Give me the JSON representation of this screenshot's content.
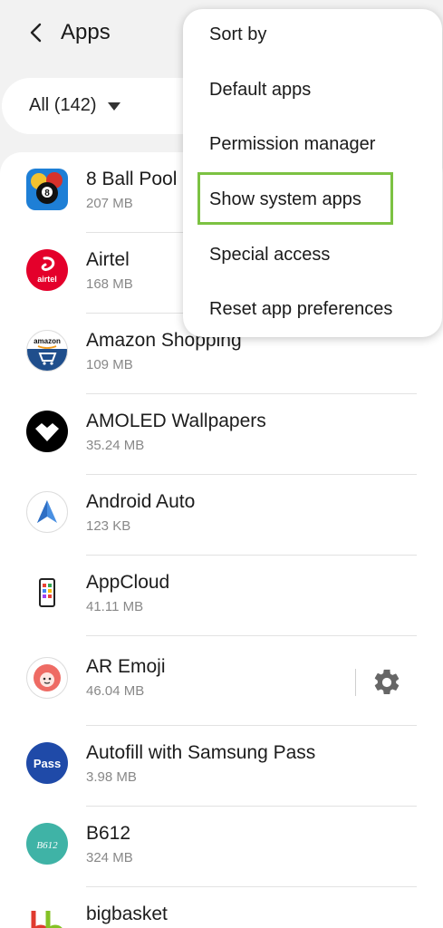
{
  "header": {
    "title": "Apps"
  },
  "filter": {
    "label": "All (142)"
  },
  "apps": [
    {
      "name": "8 Ball Pool",
      "size": "207 MB",
      "icon": "8-ball-pool-icon"
    },
    {
      "name": "Airtel",
      "size": "168 MB",
      "icon": "airtel-icon",
      "icon_text": "airtel"
    },
    {
      "name": "Amazon Shopping",
      "size": "109 MB",
      "icon": "amazon-icon",
      "icon_text": "amazon"
    },
    {
      "name": "AMOLED Wallpapers",
      "size": "35.24 MB",
      "icon": "amoled-icon"
    },
    {
      "name": "Android Auto",
      "size": "123 KB",
      "icon": "android-auto-icon"
    },
    {
      "name": "AppCloud",
      "size": "41.11 MB",
      "icon": "appcloud-icon"
    },
    {
      "name": "AR Emoji",
      "size": "46.04 MB",
      "icon": "ar-emoji-icon"
    },
    {
      "name": "Autofill with Samsung Pass",
      "size": "3.98 MB",
      "icon": "samsung-pass-icon",
      "icon_text": "Pass"
    },
    {
      "name": "B612",
      "size": "324 MB",
      "icon": "b612-icon",
      "icon_text": "B612"
    },
    {
      "name": "bigbasket",
      "size": "",
      "icon": "bigbasket-icon"
    }
  ],
  "menu": {
    "items": [
      "Sort by",
      "Default apps",
      "Permission manager",
      "Show system apps",
      "Special access",
      "Reset app preferences"
    ],
    "highlighted": "Show system apps"
  },
  "colors": {
    "background": "#f2f2f2",
    "highlight_border": "#7cc242",
    "airtel_red": "#e4002b",
    "samsung_pass_blue": "#1f4aa8",
    "b612_teal": "#3fb3a6",
    "ar_emoji_coral": "#ee6b64"
  }
}
